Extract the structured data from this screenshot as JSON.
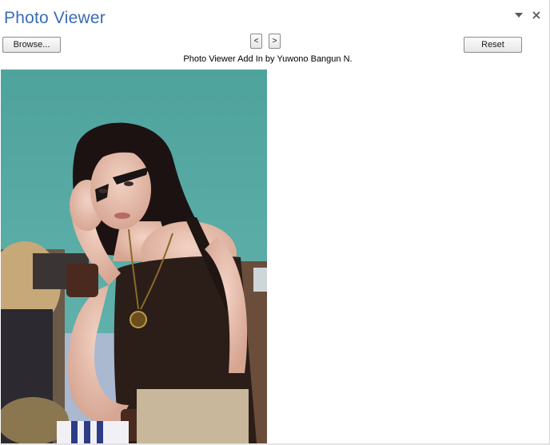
{
  "pane": {
    "title": "Photo Viewer"
  },
  "controls": {
    "dropdown_icon": "chevron-down-icon",
    "close_icon": "close-icon"
  },
  "toolbar": {
    "browse_label": "Browse...",
    "prev_label": "<",
    "next_label": ">",
    "reset_label": "Reset"
  },
  "caption": "Photo Viewer Add In by Yuwono Bangun N.",
  "colors": {
    "title": "#3a6cb5",
    "photo_background": "#5aa9a3"
  }
}
